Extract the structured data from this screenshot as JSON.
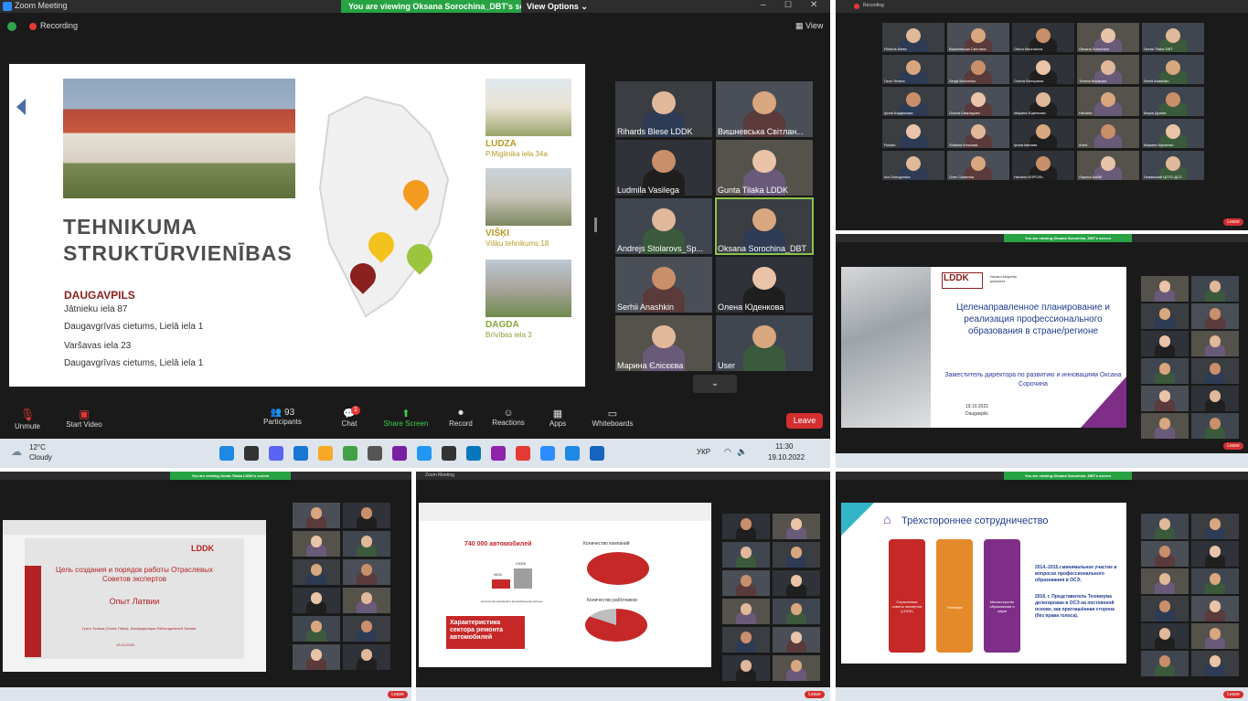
{
  "main": {
    "app_title": "Zoom Meeting",
    "banner": "You are viewing Oksana Sorochina_DBT's screen",
    "view_options": "View Options",
    "recording": "Recording",
    "view": "View",
    "slide": {
      "title_line1": "TEHNIKUMA",
      "title_line2": "STRUKTŪRVIENĪBAS",
      "city": "DAUGAVPILS",
      "addresses": [
        "Jātnieku iela 87",
        "Daugavgrīvas cietums, Lielā iela 1",
        "Varšavas iela 23",
        "Daugavgrīvas cietums, Lielā iela 1"
      ],
      "branches": [
        {
          "name": "LUDZA",
          "addr": "P.Miglinika iela 34a"
        },
        {
          "name": "VIŠĶI",
          "addr": "Višķu tehnikums 18"
        },
        {
          "name": "DAGDA",
          "addr": "Brīvības iela 3"
        }
      ]
    },
    "participants": [
      "Rihards Blese LDDK",
      "Вишневська Світлан...",
      "Ludmila Vasilega",
      "Gunta Tilaka LDDK",
      "Andrejs Stolarovs_Sp...",
      "Oksana Sorochina_DBT",
      "Serhii Anashkin",
      "Олена Юденкова",
      "Марина Єлісєєва",
      "User"
    ],
    "controls": {
      "unmute": "Unmute",
      "start_video": "Start Video",
      "participants": "Participants",
      "participants_count": "93",
      "chat": "Chat",
      "chat_badge": "1",
      "share": "Share Screen",
      "record": "Record",
      "reactions": "Reactions",
      "apps": "Apps",
      "whiteboards": "Whiteboards",
      "leave": "Leave"
    },
    "taskbar": {
      "temp": "12°C",
      "weather": "Cloudy",
      "lang": "УКР",
      "time": "11:30",
      "date": "19.10.2022"
    }
  },
  "tr_panel": {
    "recording": "Recording",
    "names": [
      "Rihards Blese",
      "Вишневська Світлана",
      "Olena Muchalova",
      "Oksana Sorochina",
      "Gunta Tilaka DBT",
      "Гала Тетяна",
      "Sergii Bochenko",
      "Олена Вікторівна",
      "Тетяна Васікова",
      "Serhii Anashkin",
      "Ірина Кордюкова",
      "Олена Свиридова",
      "Марина Юденкова",
      "Наталія",
      "Марія Дуліна",
      "Ruslan",
      "Svitlana Кількова",
      "Ірина Іванова",
      "Анна",
      "Марина Кіріченко",
      "Ina Ostrogorska",
      "Олег Семенюк",
      "Наталія КОРОЛЬ",
      "Лариса Бабій",
      "Львівський ЦПТО ДСЗ"
    ],
    "big_names": [
      "Наталія КОРОЛЬ",
      "Лариса Бабій",
      "Львівський ЦПТО..."
    ],
    "leave": "Leave"
  },
  "mr_panel": {
    "banner": "You are viewing Oksana Sorochina_DBT's screen",
    "view_options": "View Options",
    "logo": "LDDK",
    "logo2": "Nozaru ekspertu padomes",
    "title": "Целенаправленное планирование и реализация профессионального образования в стране/регионе",
    "subtitle": "Заместитель директора по развитию и инновациям Оксана Сорочина",
    "date": "19.10.2022",
    "place": "Daugavpils",
    "leave": "Leave",
    "time": "11:30",
    "tdate": "19.10.2022"
  },
  "bl_panel": {
    "banner": "You are viewing Gunta Tilaka LDDK's screen",
    "view_options": "View Options",
    "logo": "LDDK",
    "title": "Цель создания и порядок работы Отраслевых Советов экспертов",
    "subtitle": "Опыт Латвии",
    "footer": "Гунта Тилака (Gunta Tilaka), Конфедерация Работодателей Латвии",
    "date": "19.10.2022.",
    "leave": "Leave"
  },
  "bm_panel": {
    "app": "Zoom Meeting",
    "recording": "Recording",
    "cars": "740 000 автомобилей",
    "val1": "9400",
    "val2": "23000",
    "companies": "Количество компаний",
    "workers": "Количество работников",
    "left_box": "Характеристика сектора ремонта автомобилей",
    "legend": "Количество компаний в автомобильном секторе",
    "leave": "Leave"
  },
  "br_panel": {
    "banner": "You are viewing Oksana Sorochina_DBT's screen",
    "view_options": "View Options",
    "title": "Трёхстороннее сотрудничество",
    "col1": "Отраслевые советы экспертов (LDDK)",
    "col2": "Техникум",
    "col3": "Министерство образования и науки",
    "point1": "2014.-2015.г.минимальное участие в вопросах профессионального образования в ОСЭ;",
    "point2": "2016. г. Представитель Техникума делегирован в ОСЭ на постоянной основе, как приглашённая сторона (без права голоса).",
    "leave": "Leave"
  }
}
